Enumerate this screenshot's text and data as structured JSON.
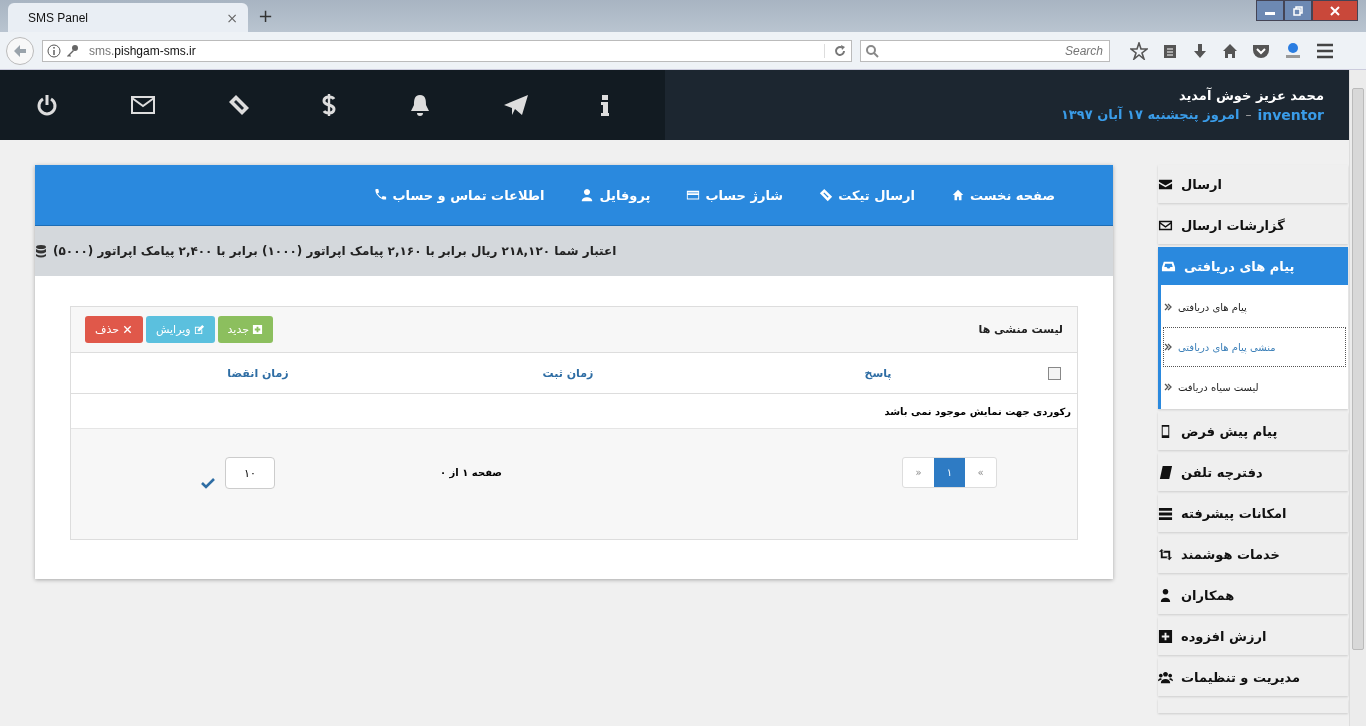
{
  "browser": {
    "tab_title": "SMS Panel",
    "tab_close": "×",
    "new_tab": "+",
    "url_host": "sms.",
    "url_domain": "pishgam-sms.ir",
    "search_placeholder": "Search"
  },
  "header": {
    "welcome": "محمد عزیز خوش آمدید",
    "username": "inventor",
    "separator": "–",
    "date": "امروز پنجشنبه ۱۷ آبان ۱۳۹۷"
  },
  "nav": {
    "items": [
      {
        "label": "صفحه نخست",
        "kind": "home"
      },
      {
        "label": "ارسال تیکت",
        "kind": "ticket"
      },
      {
        "label": "شارژ حساب",
        "kind": "card"
      },
      {
        "label": "پروفایل",
        "kind": "user"
      },
      {
        "label": "اطلاعات تماس و حساب",
        "kind": "phone"
      }
    ]
  },
  "credit": "اعتبار شما ۲۱۸,۱۲۰ ریال برابر با ۲,۱۶۰ پیامک اپراتور (۱۰۰۰) برابر با ۲,۴۰۰ پیامک اپراتور (۵۰۰۰)",
  "panel": {
    "title": "لیست منشی ها",
    "buttons": [
      {
        "label": "جدید",
        "kind": "new"
      },
      {
        "label": "ویرایش",
        "kind": "edit"
      },
      {
        "label": "حذف",
        "kind": "delete"
      }
    ],
    "select_all": {
      "checked": false
    },
    "columns": [
      "پاسخ",
      "زمان ثبت",
      "زمان انقضا"
    ],
    "empty_message": "رکوردی جهت نمایش موجود نمی باشد",
    "pagination": {
      "first": "«",
      "pages": [
        {
          "label": "۱",
          "selected": true
        }
      ],
      "last": "»"
    },
    "page_info": "صفحه ۱ از ۰",
    "page_size": "۱۰"
  },
  "sidebar": {
    "items": [
      {
        "label": "ارسال",
        "kind": "envelope",
        "selected": false
      },
      {
        "label": "گزارشات ارسال",
        "kind": "envelope-outline",
        "selected": false
      },
      {
        "label": "پیام های دریافتی",
        "kind": "inbox",
        "selected": true,
        "children": [
          {
            "label": "پیام های دریافتی",
            "selected": false
          },
          {
            "label": "منشی پیام های دریافتی",
            "selected": true
          },
          {
            "label": "لیست سیاه دریافت",
            "selected": false
          }
        ]
      },
      {
        "label": "پیام پیش فرض",
        "kind": "tablet",
        "selected": false
      },
      {
        "label": "دفترچه تلفن",
        "kind": "book",
        "selected": false
      },
      {
        "label": "امکانات پیشرفته",
        "kind": "list",
        "selected": false
      },
      {
        "label": "خدمات هوشمند",
        "kind": "retweet",
        "selected": false
      },
      {
        "label": "همکاران",
        "kind": "user",
        "selected": false
      },
      {
        "label": "ارزش افزوده",
        "kind": "plus",
        "selected": false
      },
      {
        "label": "مدیریت و تنظیمات",
        "kind": "users",
        "selected": false
      }
    ]
  }
}
